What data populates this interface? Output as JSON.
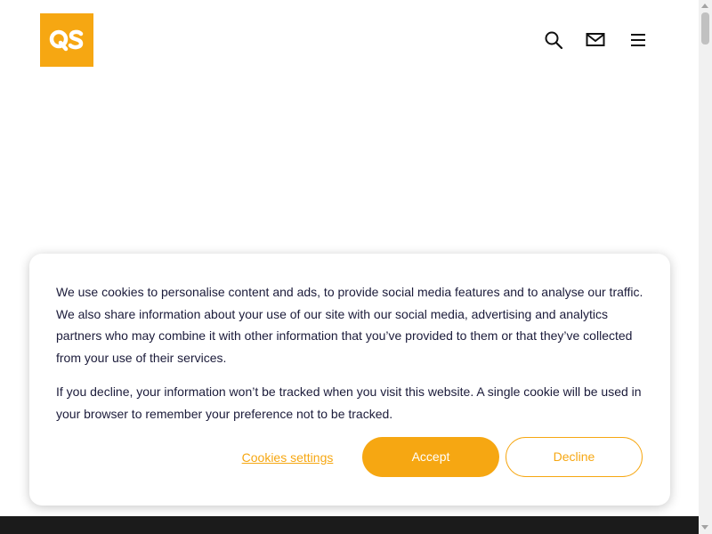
{
  "brand": {
    "logo_text": "QS",
    "accent_color": "#f6a712",
    "logo_icon": "qs-logo"
  },
  "header": {
    "icons": [
      "search-icon",
      "mail-icon",
      "menu-icon"
    ]
  },
  "cookie_banner": {
    "paragraph_1": "We use cookies to personalise content and ads, to provide social media features and to analyse our traffic. We also share information about your use of our site with our social media, advertising and analytics partners who may combine it with other information that you’ve provided to them or that they’ve collected from your use of their services.",
    "paragraph_2": "If you decline, your information won’t be tracked when you visit this website. A single cookie will be used in your browser to remember your preference not to be tracked.",
    "settings_label": "Cookies settings",
    "accept_label": "Accept",
    "decline_label": "Decline"
  },
  "footer": {
    "band_color": "#1b1b1b"
  }
}
